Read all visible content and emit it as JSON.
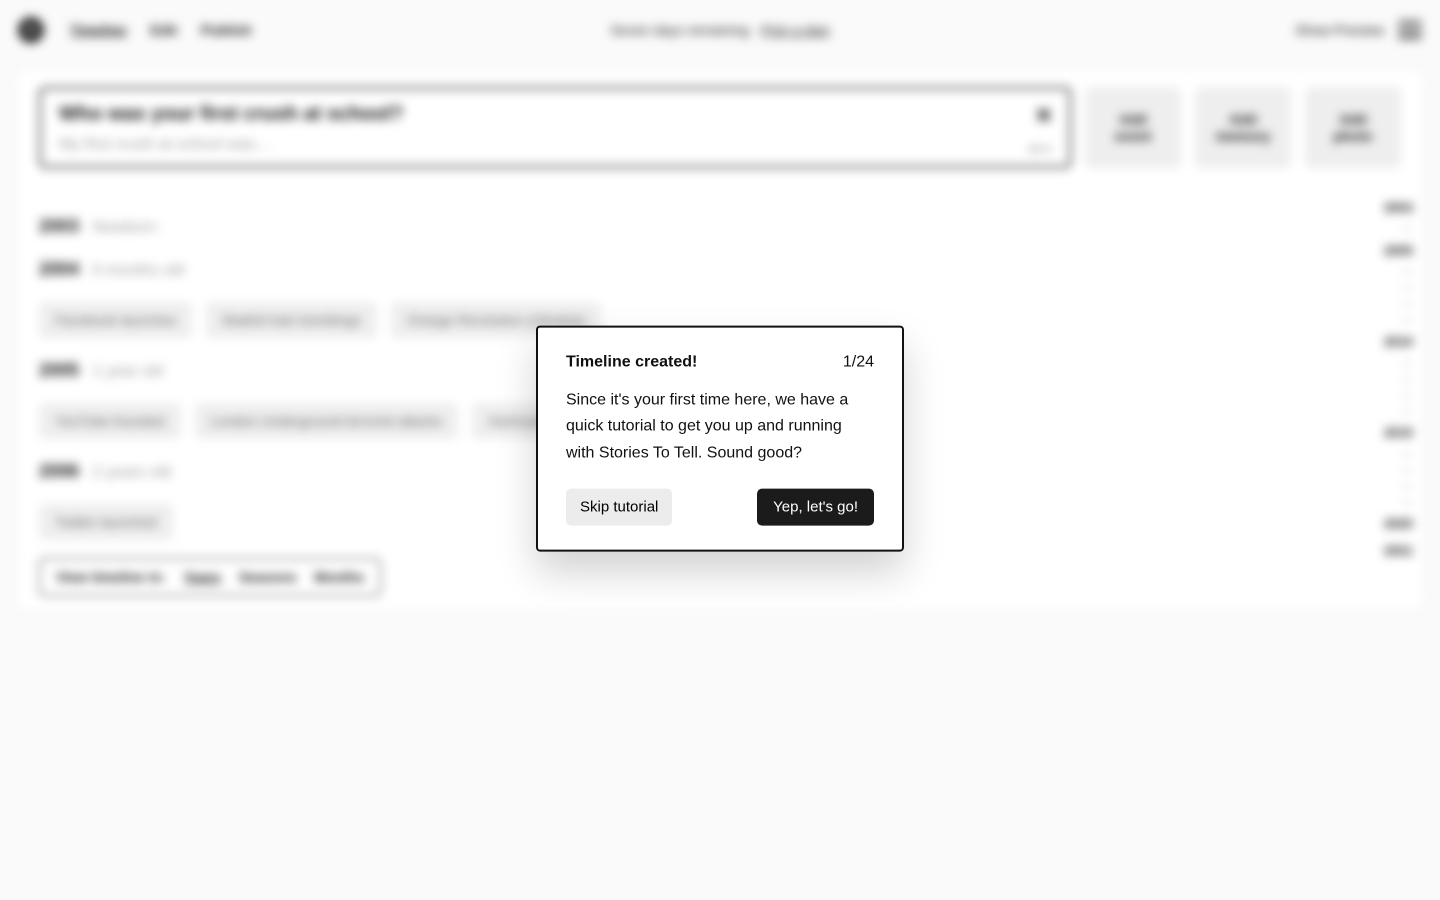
{
  "nav": {
    "links": [
      "Timeline",
      "Edit",
      "Publish"
    ],
    "active": 0,
    "center_left": "Seven days remaining · ",
    "center_link": "Pick a plan",
    "preview": "Show Preview"
  },
  "prompt": {
    "title": "Who was your first crush at school?",
    "placeholder": "My first crush at school was…",
    "all": "All ▾"
  },
  "add_buttons": [
    {
      "l1": "Add",
      "l2": "event"
    },
    {
      "l1": "Add",
      "l2": "memory"
    },
    {
      "l1": "Add",
      "l2": "photo"
    }
  ],
  "timeline": [
    {
      "year": "2003",
      "sub": "· Newborn",
      "chips": []
    },
    {
      "year": "2004",
      "sub": "· 6 months old",
      "chips": [
        "Facebook launches",
        "Madrid train bombings",
        "Orange Revolution (Ukraine)"
      ]
    },
    {
      "year": "2005",
      "sub": "· 1 year old",
      "chips": [
        "YouTube founded",
        "London Underground terrorist attacks",
        "Hurricane Katrina"
      ]
    },
    {
      "year": "2006",
      "sub": "· 2 years old",
      "chips": [
        "Twitter launched"
      ]
    }
  ],
  "rail": [
    {
      "t": "2003",
      "b": true
    },
    {
      "t": "·"
    },
    {
      "t": "2005",
      "b": true
    },
    {
      "t": "·"
    },
    {
      "t": "·"
    },
    {
      "t": "·"
    },
    {
      "t": "·"
    },
    {
      "t": "2010",
      "b": true
    },
    {
      "t": "·"
    },
    {
      "t": "·"
    },
    {
      "t": "·"
    },
    {
      "t": "·"
    },
    {
      "t": "2015",
      "b": true
    },
    {
      "t": "·"
    },
    {
      "t": "·"
    },
    {
      "t": "·"
    },
    {
      "t": "·"
    },
    {
      "t": "2020",
      "b": true
    },
    {
      "t": "2021",
      "b": true
    }
  ],
  "view": {
    "label": "View timeline in:",
    "opts": [
      "Years",
      "Seasons",
      "Months"
    ],
    "active": 0
  },
  "modal": {
    "title": "Timeline created!",
    "step": "1/24",
    "body": "Since it's your first time here, we have a quick tutorial to get you up and running with Stories To Tell. Sound good?",
    "skip": "Skip tutorial",
    "go": "Yep, let's go!"
  }
}
